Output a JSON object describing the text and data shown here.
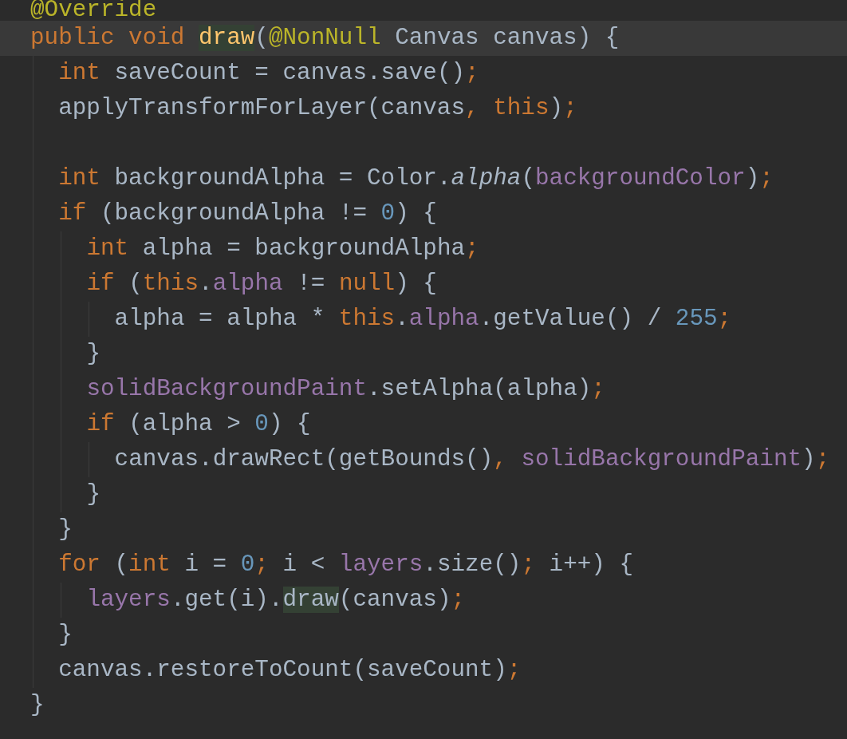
{
  "editor": {
    "lines": [
      {
        "kind": "code",
        "current": false,
        "tokens": [
          {
            "kind": "ann",
            "text": "@Override"
          }
        ]
      },
      {
        "kind": "code",
        "current": true,
        "tokens": [
          {
            "kind": "kw",
            "text": "public void "
          },
          {
            "kind": "fn-hl",
            "text": "draw"
          },
          {
            "kind": "plain",
            "text": "("
          },
          {
            "kind": "ann",
            "text": "@NonNull"
          },
          {
            "kind": "plain",
            "text": " Canvas canvas) {"
          }
        ],
        "children": [
          {
            "kind": "code",
            "current": false,
            "tokens": [
              {
                "kind": "kw",
                "text": "int "
              },
              {
                "kind": "plain",
                "text": "saveCount = canvas.save()"
              },
              {
                "kind": "kw",
                "text": ";"
              }
            ]
          },
          {
            "kind": "code",
            "current": false,
            "tokens": [
              {
                "kind": "plain",
                "text": "applyTransformForLayer(canvas"
              },
              {
                "kind": "kw",
                "text": ", this"
              },
              {
                "kind": "plain",
                "text": ")"
              },
              {
                "kind": "kw",
                "text": ";"
              }
            ]
          },
          {
            "kind": "blank"
          },
          {
            "kind": "code",
            "current": false,
            "tokens": [
              {
                "kind": "kw",
                "text": "int "
              },
              {
                "kind": "plain",
                "text": "backgroundAlpha = Color."
              },
              {
                "kind": "static",
                "text": "alpha"
              },
              {
                "kind": "plain",
                "text": "("
              },
              {
                "kind": "field",
                "text": "backgroundColor"
              },
              {
                "kind": "plain",
                "text": ")"
              },
              {
                "kind": "kw",
                "text": ";"
              }
            ]
          },
          {
            "kind": "code",
            "current": false,
            "tokens": [
              {
                "kind": "kw",
                "text": "if "
              },
              {
                "kind": "plain",
                "text": "(backgroundAlpha != "
              },
              {
                "kind": "num",
                "text": "0"
              },
              {
                "kind": "plain",
                "text": ") {"
              }
            ],
            "children": [
              {
                "kind": "code",
                "current": false,
                "tokens": [
                  {
                    "kind": "kw",
                    "text": "int "
                  },
                  {
                    "kind": "plain",
                    "text": "alpha = backgroundAlpha"
                  },
                  {
                    "kind": "kw",
                    "text": ";"
                  }
                ]
              },
              {
                "kind": "code",
                "current": false,
                "tokens": [
                  {
                    "kind": "kw",
                    "text": "if "
                  },
                  {
                    "kind": "plain",
                    "text": "("
                  },
                  {
                    "kind": "kw",
                    "text": "this"
                  },
                  {
                    "kind": "plain",
                    "text": "."
                  },
                  {
                    "kind": "field",
                    "text": "alpha"
                  },
                  {
                    "kind": "plain",
                    "text": " != "
                  },
                  {
                    "kind": "kw",
                    "text": "null"
                  },
                  {
                    "kind": "plain",
                    "text": ") {"
                  }
                ],
                "children": [
                  {
                    "kind": "code",
                    "current": false,
                    "tokens": [
                      {
                        "kind": "plain",
                        "text": "alpha = alpha * "
                      },
                      {
                        "kind": "kw",
                        "text": "this"
                      },
                      {
                        "kind": "plain",
                        "text": "."
                      },
                      {
                        "kind": "field",
                        "text": "alpha"
                      },
                      {
                        "kind": "plain",
                        "text": ".getValue() / "
                      },
                      {
                        "kind": "num",
                        "text": "255"
                      },
                      {
                        "kind": "kw",
                        "text": ";"
                      }
                    ]
                  }
                ]
              },
              {
                "kind": "code",
                "current": false,
                "tokens": [
                  {
                    "kind": "plain",
                    "text": "}"
                  }
                ]
              },
              {
                "kind": "code",
                "current": false,
                "tokens": [
                  {
                    "kind": "field",
                    "text": "solidBackgroundPaint"
                  },
                  {
                    "kind": "plain",
                    "text": ".setAlpha(alpha)"
                  },
                  {
                    "kind": "kw",
                    "text": ";"
                  }
                ]
              },
              {
                "kind": "code",
                "current": false,
                "tokens": [
                  {
                    "kind": "kw",
                    "text": "if "
                  },
                  {
                    "kind": "plain",
                    "text": "(alpha > "
                  },
                  {
                    "kind": "num",
                    "text": "0"
                  },
                  {
                    "kind": "plain",
                    "text": ") {"
                  }
                ],
                "children": [
                  {
                    "kind": "code",
                    "current": false,
                    "tokens": [
                      {
                        "kind": "plain",
                        "text": "canvas.drawRect(getBounds()"
                      },
                      {
                        "kind": "kw",
                        "text": ", "
                      },
                      {
                        "kind": "field",
                        "text": "solidBackgroundPaint"
                      },
                      {
                        "kind": "plain",
                        "text": ")"
                      },
                      {
                        "kind": "kw",
                        "text": ";"
                      }
                    ]
                  }
                ]
              },
              {
                "kind": "code",
                "current": false,
                "tokens": [
                  {
                    "kind": "plain",
                    "text": "}"
                  }
                ]
              }
            ]
          },
          {
            "kind": "code",
            "current": false,
            "tokens": [
              {
                "kind": "plain",
                "text": "}"
              }
            ]
          },
          {
            "kind": "code",
            "current": false,
            "tokens": [
              {
                "kind": "kw",
                "text": "for "
              },
              {
                "kind": "plain",
                "text": "("
              },
              {
                "kind": "kw",
                "text": "int "
              },
              {
                "kind": "plain",
                "text": "i = "
              },
              {
                "kind": "num",
                "text": "0"
              },
              {
                "kind": "kw",
                "text": "; "
              },
              {
                "kind": "plain",
                "text": "i < "
              },
              {
                "kind": "field",
                "text": "layers"
              },
              {
                "kind": "plain",
                "text": ".size()"
              },
              {
                "kind": "kw",
                "text": "; "
              },
              {
                "kind": "plain",
                "text": "i++) {"
              }
            ],
            "children": [
              {
                "kind": "code",
                "current": false,
                "tokens": [
                  {
                    "kind": "field",
                    "text": "layers"
                  },
                  {
                    "kind": "plain",
                    "text": ".get(i)."
                  },
                  {
                    "kind": "plain-hl",
                    "text": "draw"
                  },
                  {
                    "kind": "plain",
                    "text": "(canvas)"
                  },
                  {
                    "kind": "kw",
                    "text": ";"
                  }
                ]
              }
            ]
          },
          {
            "kind": "code",
            "current": false,
            "tokens": [
              {
                "kind": "plain",
                "text": "}"
              }
            ]
          },
          {
            "kind": "code",
            "current": false,
            "tokens": [
              {
                "kind": "plain",
                "text": "canvas.restoreToCount(saveCount)"
              },
              {
                "kind": "kw",
                "text": ";"
              }
            ]
          }
        ]
      },
      {
        "kind": "code",
        "current": false,
        "tokens": [
          {
            "kind": "plain",
            "text": "}"
          }
        ]
      }
    ]
  }
}
